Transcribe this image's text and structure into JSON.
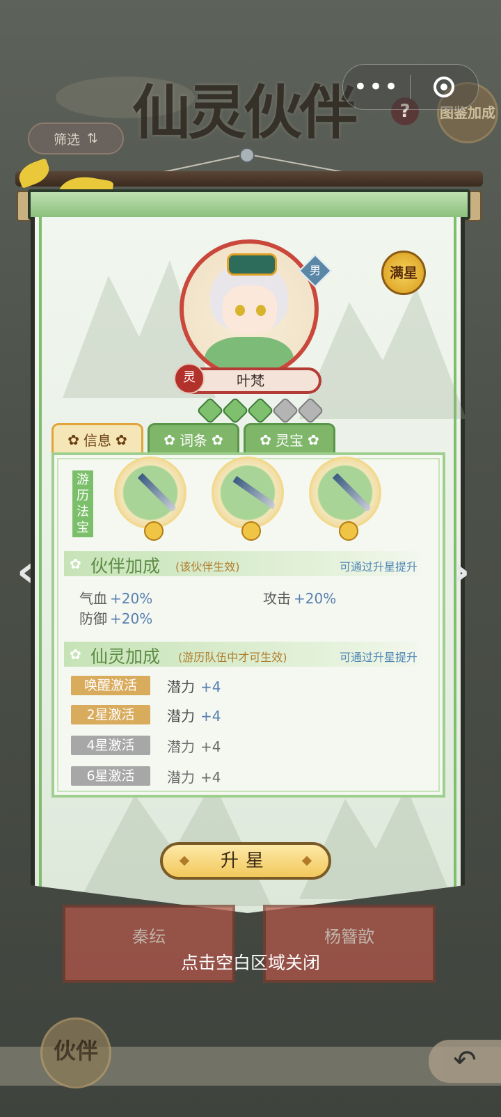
{
  "header": {
    "title": "仙灵伙伴",
    "filter_label": "筛选",
    "filter_icon": "sort-arrows-icon",
    "help_label": "?",
    "bonus_badge": "图鉴加成"
  },
  "capsule": {
    "more_icon": "more-dots-icon",
    "close_icon": "target-close-icon"
  },
  "character": {
    "name": "叶梵",
    "gender": "男",
    "element": "灵",
    "full_star_badge": "满星",
    "stars_total": 5,
    "stars_lit": 3
  },
  "tabs": [
    {
      "label": "信息",
      "active": true
    },
    {
      "label": "词条",
      "active": false
    },
    {
      "label": "灵宝",
      "active": false
    }
  ],
  "fabao": {
    "label": "游历法宝",
    "items": [
      {
        "name": "sword-weapon",
        "coin": "金"
      },
      {
        "name": "curved-blade-weapon",
        "coin": "金"
      },
      {
        "name": "sword-weapon",
        "coin": "金"
      }
    ]
  },
  "partner_bonus": {
    "title": "伙伴加成",
    "note": "(该伙伴生效)",
    "hint": "可通过升星提升",
    "stats": [
      {
        "label": "气血",
        "value": "+20%"
      },
      {
        "label": "攻击",
        "value": "+20%"
      },
      {
        "label": "防御",
        "value": "+20%"
      }
    ]
  },
  "spirit_bonus": {
    "title": "仙灵加成",
    "note": "(游历队伍中才可生效)",
    "hint": "可通过升星提升",
    "rows": [
      {
        "tag": "唤醒激活",
        "stat": "潜力",
        "value": "+4",
        "active": true
      },
      {
        "tag": "2星激活",
        "stat": "潜力",
        "value": "+4",
        "active": true
      },
      {
        "tag": "4星激活",
        "stat": "潜力",
        "value": "+4",
        "active": false
      },
      {
        "tag": "6星激活",
        "stat": "潜力",
        "value": "+4",
        "active": false
      }
    ]
  },
  "upgrade_label": "升星",
  "background_cards": [
    "秦纭",
    "杨簪歆"
  ],
  "close_tip": "点击空白区域关闭",
  "bottom": {
    "huoban_label": "伙伴",
    "back_icon": "back-arrow-icon"
  },
  "colors": {
    "accent_green": "#7fbf6c",
    "gold": "#d9ab5d",
    "red": "#c9473b",
    "blue_value": "#5880b0"
  }
}
